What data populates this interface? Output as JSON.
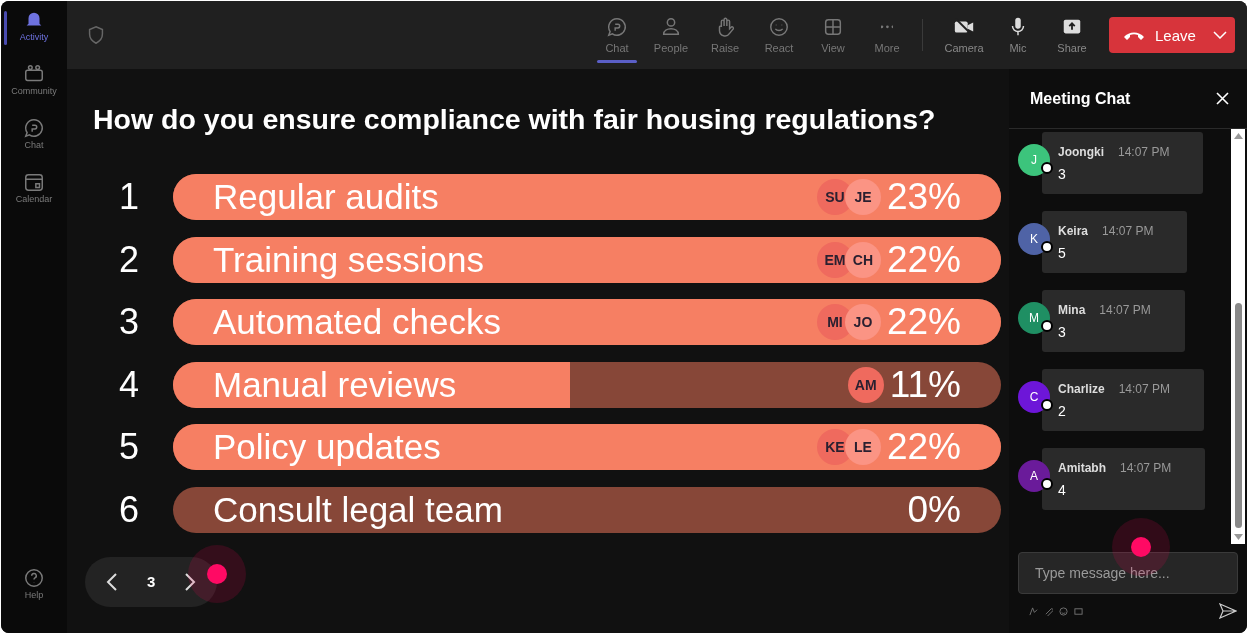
{
  "sidebar": {
    "items": [
      {
        "label": "Activity",
        "kind": "bell",
        "selected": true
      },
      {
        "label": "Community",
        "kind": "community",
        "selected": false
      },
      {
        "label": "Chat",
        "kind": "chat",
        "selected": false
      },
      {
        "label": "Calendar",
        "kind": "calendar",
        "selected": false
      }
    ],
    "help": {
      "label": "Help"
    }
  },
  "toolbar": {
    "items": [
      {
        "label": "Chat",
        "kind": "chat",
        "selected": true
      },
      {
        "label": "People",
        "kind": "person",
        "selected": false
      },
      {
        "label": "Raise",
        "kind": "hand",
        "selected": false
      },
      {
        "label": "React",
        "kind": "smile",
        "selected": false
      },
      {
        "label": "View",
        "kind": "grid",
        "selected": false
      },
      {
        "label": "More",
        "kind": "dots",
        "selected": false
      }
    ],
    "devices": [
      {
        "label": "Camera",
        "kind": "camera"
      },
      {
        "label": "Mic",
        "kind": "mic"
      },
      {
        "label": "Share",
        "kind": "share"
      }
    ],
    "leave": {
      "label": "Leave"
    }
  },
  "poll": {
    "question": "How do you ensure compliance with fair housing regulations?",
    "options": [
      {
        "number": "1",
        "label": "Regular audits",
        "level": 1,
        "percent": "23%",
        "voters": [
          "SU",
          "JE"
        ]
      },
      {
        "number": "2",
        "label": "Training sessions",
        "level": 1,
        "percent": "22%",
        "voters": [
          "EM",
          "CH"
        ]
      },
      {
        "number": "3",
        "label": "Automated checks",
        "level": 1,
        "percent": "22%",
        "voters": [
          "MI",
          "JO"
        ]
      },
      {
        "number": "4",
        "label": "Manual reviews",
        "level": 0.48,
        "percent": "11%",
        "voters": [
          "AM"
        ]
      },
      {
        "number": "5",
        "label": "Policy updates",
        "level": 1,
        "percent": "22%",
        "voters": [
          "KE",
          "LE"
        ]
      },
      {
        "number": "6",
        "label": "Consult legal team",
        "level": 0,
        "percent": "0%"
      }
    ],
    "page": "3"
  },
  "chat": {
    "title": "Meeting Chat",
    "messages": [
      {
        "initial": "J",
        "name": "Joongki",
        "time": "14:07 PM",
        "text": "3",
        "color": "#3cc47c"
      },
      {
        "initial": "K",
        "name": "Keira",
        "time": "14:07 PM",
        "text": "5",
        "color": "#4f63a6"
      },
      {
        "initial": "M",
        "name": "Mina",
        "time": "14:07 PM",
        "text": "3",
        "color": "#1f8f63"
      },
      {
        "initial": "C",
        "name": "Charlize",
        "time": "14:07 PM",
        "text": "2",
        "color": "#6d16d8"
      },
      {
        "initial": "A",
        "name": "Amitabh",
        "time": "14:07 PM",
        "text": "4",
        "color": "#6a1b9a"
      }
    ],
    "input": {
      "placeholder": "Type message here..."
    }
  }
}
